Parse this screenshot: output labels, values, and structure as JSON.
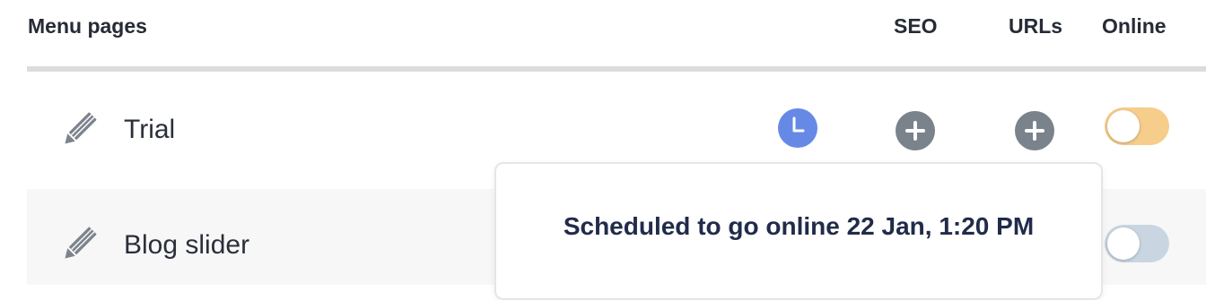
{
  "header": {
    "title": "Menu pages",
    "seo": "SEO",
    "urls": "URLs",
    "online": "Online"
  },
  "rows": [
    {
      "label": "Trial",
      "icon": "pencil-icon",
      "status_icon": "clock-icon",
      "seo_icon": "plus-icon",
      "urls_icon": "plus-icon",
      "online": true,
      "toggle_color": "#f6cd8b"
    },
    {
      "label": "Blog slider",
      "icon": "pencil-icon",
      "online": false,
      "toggle_color": "#c9d6e2"
    }
  ],
  "tooltip": {
    "text": "Scheduled to go online 22 Jan, 1:20 PM"
  },
  "colors": {
    "clock": "#6789e6",
    "plus": "#7a828c",
    "text": "#2a2f3a",
    "tooltip_text": "#212b4a"
  }
}
